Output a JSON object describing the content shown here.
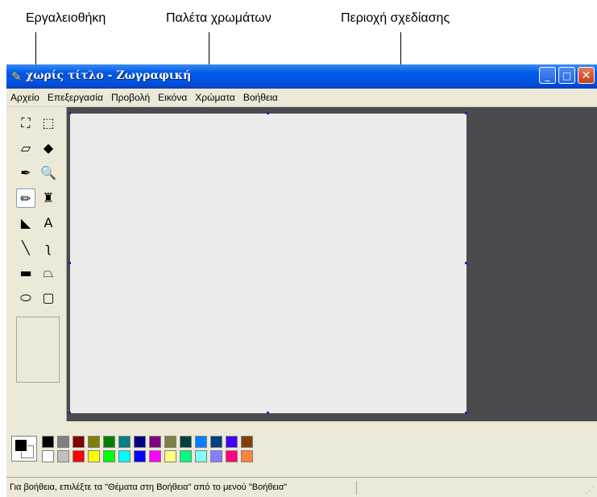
{
  "annotations": {
    "toolbox": "Εργαλειοθήκη",
    "palette": "Παλέτα χρωμάτων",
    "drawing_area": "Περιοχή σχεδίασης"
  },
  "window": {
    "title": "χωρίς τίτλο - Ζωγραφική",
    "controls": {
      "minimize": "_",
      "maximize": "□",
      "close": "✕"
    }
  },
  "menu": [
    "Αρχείο",
    "Επεξεργασία",
    "Προβολή",
    "Εικόνα",
    "Χρώματα",
    "Βοήθεια"
  ],
  "tools": [
    {
      "name": "free-select-icon",
      "glyph": "⛶"
    },
    {
      "name": "rect-select-icon",
      "glyph": "⬚"
    },
    {
      "name": "eraser-icon",
      "glyph": "▱"
    },
    {
      "name": "fill-bucket-icon",
      "glyph": "◆"
    },
    {
      "name": "color-picker-icon",
      "glyph": "✒"
    },
    {
      "name": "magnifier-icon",
      "glyph": "🔍"
    },
    {
      "name": "pencil-icon",
      "glyph": "✏",
      "selected": true
    },
    {
      "name": "brush-icon",
      "glyph": "♜"
    },
    {
      "name": "airbrush-icon",
      "glyph": "◣"
    },
    {
      "name": "text-icon",
      "glyph": "A"
    },
    {
      "name": "line-icon",
      "glyph": "╲"
    },
    {
      "name": "curve-icon",
      "glyph": "ʅ"
    },
    {
      "name": "rectangle-icon",
      "glyph": "▬"
    },
    {
      "name": "polygon-icon",
      "glyph": "⏢"
    },
    {
      "name": "ellipse-icon",
      "glyph": "⬭"
    },
    {
      "name": "rounded-rect-icon",
      "glyph": "▢"
    }
  ],
  "palette": {
    "top_row": [
      "#000000",
      "#808080",
      "#800000",
      "#808000",
      "#008000",
      "#008080",
      "#000080",
      "#800080",
      "#808040",
      "#004040",
      "#0080ff",
      "#004080",
      "#4000ff",
      "#804000"
    ],
    "bottom_row": [
      "#ffffff",
      "#c0c0c0",
      "#ff0000",
      "#ffff00",
      "#00ff00",
      "#00ffff",
      "#0000ff",
      "#ff00ff",
      "#ffff80",
      "#00ff80",
      "#80ffff",
      "#8080ff",
      "#ff0080",
      "#ff8040"
    ],
    "foreground": "#000000",
    "background": "#ffffff"
  },
  "status": {
    "help_text": "Για βοήθεια, επιλέξτε τα \"Θέματα στη Βοήθεια\" από το μενού \"Βοήθεια\""
  }
}
